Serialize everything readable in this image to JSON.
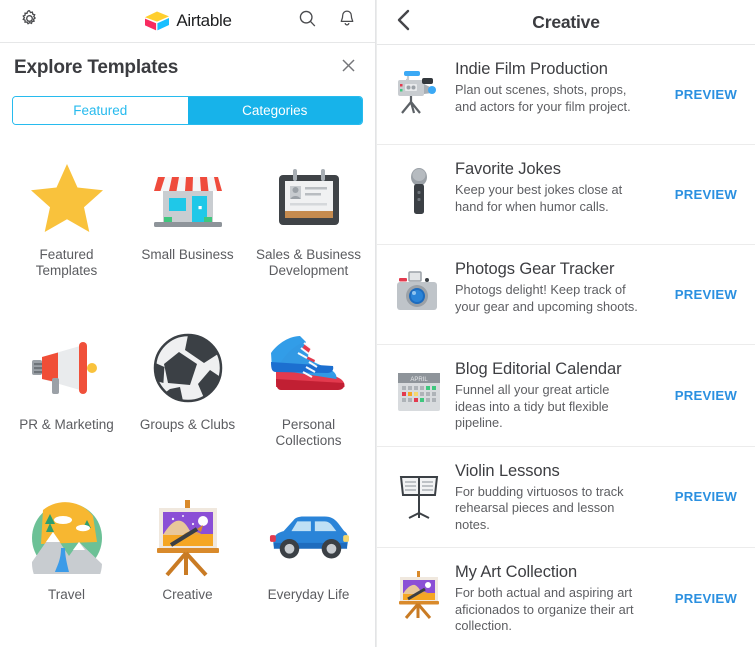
{
  "app_bar": {
    "gear_icon": "gear-icon",
    "brand_name": "Airtable",
    "search_icon": "search-icon",
    "bell_icon": "bell-icon",
    "logo_colors": {
      "yellow": "#FFCF2F",
      "red": "#F82B60",
      "cyan": "#18BFFF"
    }
  },
  "explore": {
    "title": "Explore Templates",
    "close_icon": "close-icon",
    "tabs": [
      {
        "label": "Featured",
        "active": false
      },
      {
        "label": "Categories",
        "active": true
      }
    ],
    "accent": "#17b3ea"
  },
  "categories": [
    {
      "label": "Featured Templates",
      "icon": "star-icon"
    },
    {
      "label": "Small Business",
      "icon": "storefront-icon"
    },
    {
      "label": "Sales & Business Development",
      "icon": "rolodex-icon"
    },
    {
      "label": "PR & Marketing",
      "icon": "megaphone-icon"
    },
    {
      "label": "Groups & Clubs",
      "icon": "soccer-ball-icon"
    },
    {
      "label": "Personal Collections",
      "icon": "sneakers-icon"
    },
    {
      "label": "Travel",
      "icon": "mountain-icon"
    },
    {
      "label": "Creative",
      "icon": "easel-icon"
    },
    {
      "label": "Everyday Life",
      "icon": "car-icon"
    }
  ],
  "detail": {
    "back_icon": "back-chevron-icon",
    "title": "Creative",
    "preview_label": "PREVIEW",
    "preview_color": "#2b90e0",
    "templates": [
      {
        "title": "Indie Film Production",
        "description": "Plan out scenes, shots, props, and actors for your film project.",
        "icon": "movie-camera-icon",
        "preview_label": "PREVIEW"
      },
      {
        "title": "Favorite Jokes",
        "description": "Keep your best jokes close at hand for when humor calls.",
        "icon": "microphone-icon",
        "preview_label": "PREVIEW"
      },
      {
        "title": "Photogs Gear Tracker",
        "description": "Photogs delight! Keep track of your gear and upcoming shoots.",
        "icon": "camera-icon",
        "preview_label": "PREVIEW"
      },
      {
        "title": "Blog Editorial Calendar",
        "description": "Funnel all your great article ideas into a tidy but flexible pipeline.",
        "icon": "calendar-icon",
        "preview_label": "PREVIEW"
      },
      {
        "title": "Violin Lessons",
        "description": "For budding virtuosos to track rehearsal pieces and lesson notes.",
        "icon": "music-stand-icon",
        "preview_label": "PREVIEW"
      },
      {
        "title": "My Art Collection",
        "description": "For both actual and aspiring art aficionados to organize their art collection.",
        "icon": "easel-icon",
        "preview_label": "PREVIEW"
      }
    ]
  }
}
